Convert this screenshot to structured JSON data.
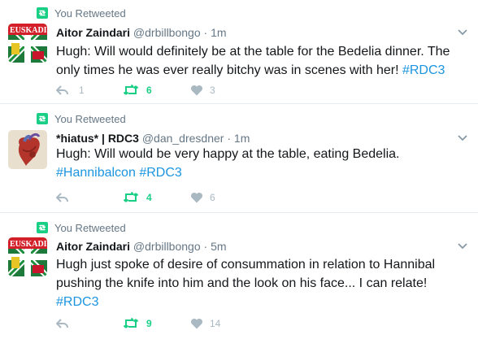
{
  "retweet_label": "You Retweeted",
  "tweets": [
    {
      "name": "Aitor Zaindari",
      "handle": "@drbillbongo",
      "separator": "·",
      "time": "1m",
      "text_parts": [
        "Hugh: Will would definitely be at the table for the Bedelia dinner. The only times he was ever really bitchy was in scenes with her! "
      ],
      "hashtags": [
        "#RDC3"
      ],
      "reply_count": "1",
      "retweet_count": "6",
      "like_count": "3",
      "avatar": "euskadi-flag-avatar"
    },
    {
      "name": "*hiatus* | RDC3",
      "handle": "@dan_dresdner",
      "separator": "·",
      "time": "1m",
      "text_parts": [
        "Hugh: Will would be very happy at the table, eating Bedelia."
      ],
      "hashtags": [
        "#Hannibalcon",
        "#RDC3"
      ],
      "reply_count": "",
      "retweet_count": "4",
      "like_count": "6",
      "avatar": "anatomical-heart-avatar"
    },
    {
      "name": "Aitor Zaindari",
      "handle": "@drbillbongo",
      "separator": "·",
      "time": "5m",
      "text_parts": [
        "Hugh just spoke of desire of consummation in relation to Hannibal pushing the knife into him and the look on his face... I can relate!"
      ],
      "hashtags": [
        "#RDC3"
      ],
      "reply_count": "",
      "retweet_count": "9",
      "like_count": "14",
      "avatar": "euskadi-flag-avatar"
    }
  ],
  "colors": {
    "retweet": "#19cf86",
    "hashtag": "#1b95e0",
    "muted": "#657786",
    "icon": "#aab8c2"
  }
}
